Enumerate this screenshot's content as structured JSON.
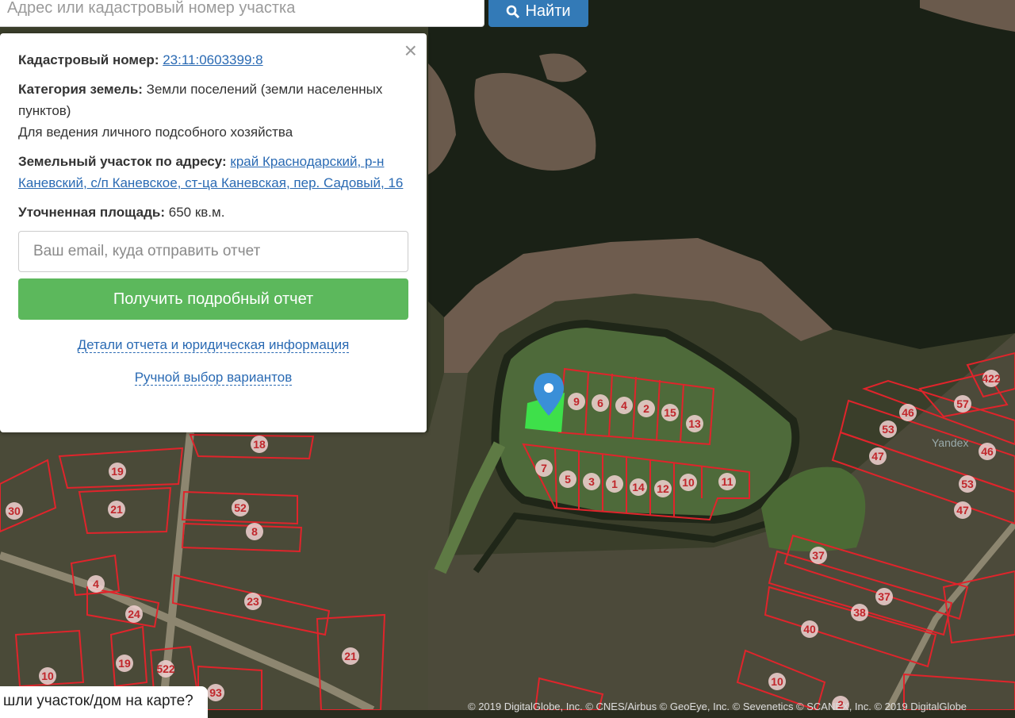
{
  "search": {
    "placeholder": "Адрес или кадастровый номер участка",
    "button_label": "Найти"
  },
  "panel": {
    "cadastral_label": "Кадастровый номер:",
    "cadastral_value": "23:11:0603399:8",
    "category_label": "Категория земель:",
    "category_value": "Земли поселений (земли населенных пунктов)",
    "usage": "Для ведения личного подсобного хозяйства",
    "address_label": "Земельный участок по адресу:",
    "address_value": "край Краснодарский, р-н Каневский, с/п Каневское, ст-ца Каневская, пер. Садовый, 16",
    "area_label": "Уточненная площадь:",
    "area_value": "650 кв.м.",
    "email_placeholder": "Ваш email, куда отправить отчет",
    "submit_label": "Получить подробный отчет",
    "details_link": "Детали отчета и юридическая информация",
    "manual_link": "Ручной выбор вариантов",
    "close_symbol": "×"
  },
  "map": {
    "parcel_numbers": [
      "9",
      "6",
      "4",
      "2",
      "15",
      "13",
      "7",
      "5",
      "3",
      "1",
      "14",
      "12",
      "10",
      "11",
      "18",
      "19",
      "21",
      "30",
      "52",
      "8",
      "4",
      "24",
      "23",
      "19",
      "10",
      "522",
      "21",
      "93",
      "46",
      "57",
      "422",
      "53",
      "47",
      "46",
      "53",
      "47",
      "37",
      "37",
      "38",
      "40",
      "10",
      "2"
    ],
    "watermark": "Yandex",
    "colors": {
      "water": "#1d2418",
      "parcel_line": "#e0242b",
      "selected_parcel": "#3ee04a",
      "marker": "#3a8fd8"
    }
  },
  "bottom_bubble": "шли участок/дом на карте?",
  "copyright": "© 2019 DigitalGlobe, Inc. © CNES/Airbus © GeoEye, Inc. © Sevenetics © SCANEX, Inc. © 2019 DigitalGlobe"
}
